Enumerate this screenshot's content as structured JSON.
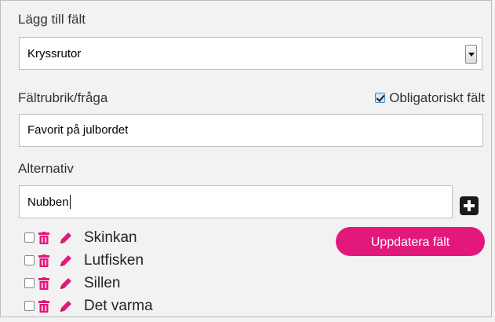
{
  "add_field_label": "Lägg till fält",
  "field_type": {
    "selected": "Kryssrutor"
  },
  "question_label": "Fältrubrik/fråga",
  "required": {
    "label": "Obligatoriskt fält",
    "checked": true
  },
  "question_input": {
    "value": "Favorit på julbordet"
  },
  "alternatives_label": "Alternativ",
  "alternative_input": {
    "value": "Nubben"
  },
  "options": [
    {
      "label": "Skinkan"
    },
    {
      "label": "Lutfisken"
    },
    {
      "label": "Sillen"
    },
    {
      "label": "Det varma"
    }
  ],
  "update_button_label": "Uppdatera fält",
  "colors": {
    "accent": "#e3187b",
    "icon_pink": "#e3187b"
  },
  "icons": {
    "add": "plus-square-icon",
    "delete": "trash-icon",
    "edit": "pencil-icon"
  }
}
